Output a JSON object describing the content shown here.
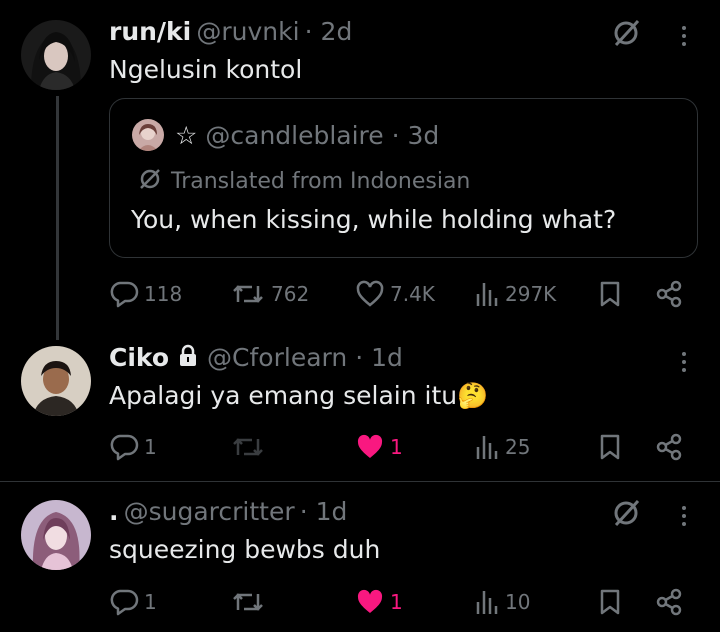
{
  "tweets": [
    {
      "name": "run/ki",
      "handle": "@ruvnki",
      "time": "· 2d",
      "text": "Ngelusin kontol",
      "quote": {
        "star": "☆",
        "handle": "@candleblaire",
        "time": "· 3d",
        "translated_label": "Translated from Indonesian",
        "text": "You, when kissing, while holding what?"
      },
      "stats": {
        "replies": "118",
        "reposts": "762",
        "likes": "7.4K",
        "views": "297K"
      }
    },
    {
      "name": "Ciko",
      "handle": "@Cforlearn",
      "time": "· 1d",
      "text": "Apalagi ya emang selain itu",
      "emoji": "🤔",
      "stats": {
        "replies": "1",
        "reposts": "",
        "likes": "1",
        "views": "25"
      }
    },
    {
      "name": ".",
      "handle": "@sugarcritter",
      "time": "· 1d",
      "text": "squeezing bewbs duh",
      "stats": {
        "replies": "1",
        "reposts": "",
        "likes": "1",
        "views": "10"
      }
    }
  ],
  "colors": {
    "background": "#000000",
    "text": "#e7e9ea",
    "muted": "#71767b",
    "like": "#f91880",
    "border": "#2f3336"
  }
}
